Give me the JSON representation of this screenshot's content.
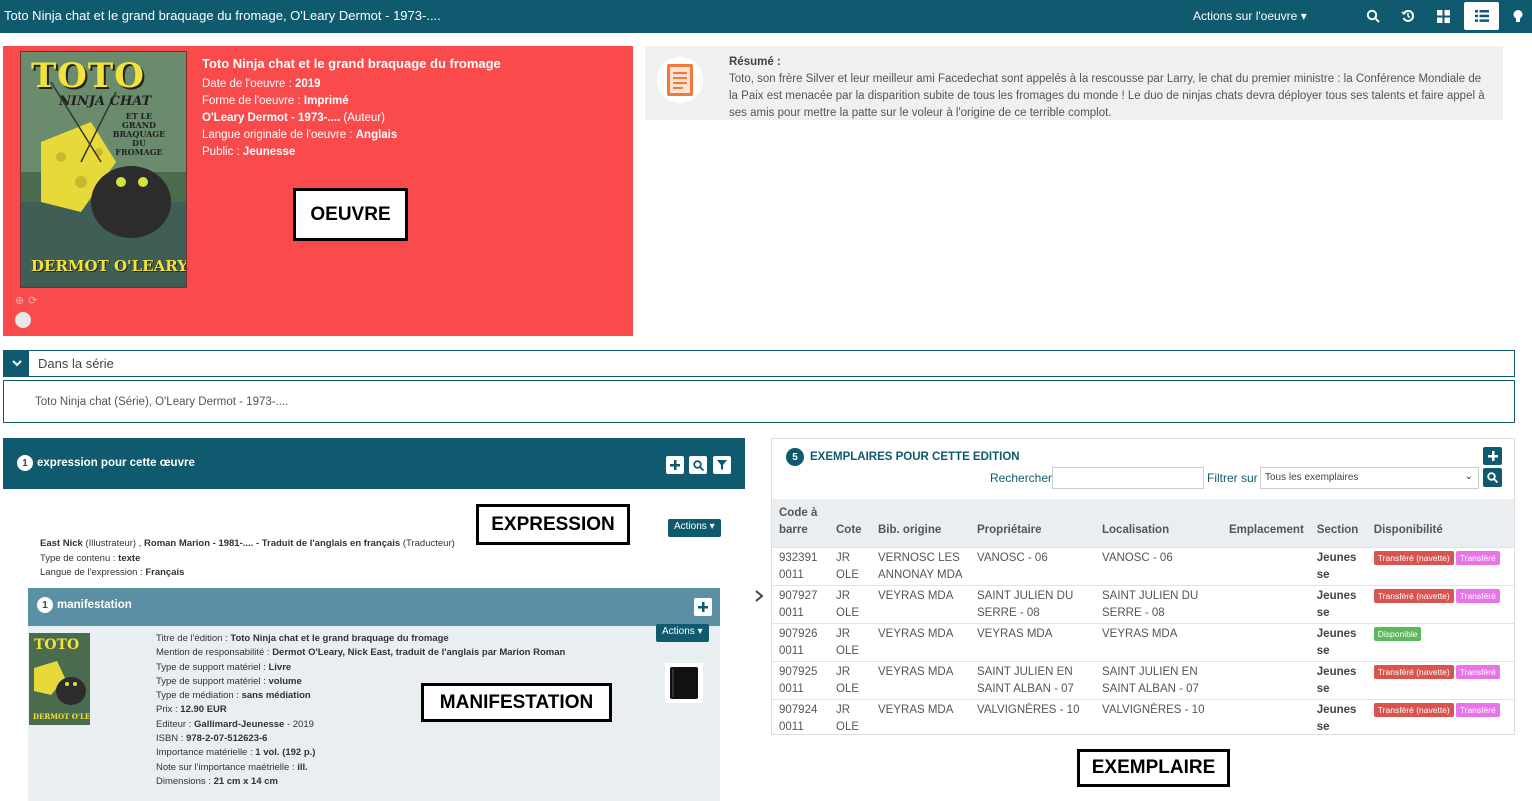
{
  "topbar": {
    "title": "Toto Ninja chat et le grand braquage du fromage, O'Leary Dermot - 1973-....",
    "actions_label": "Actions sur l'oeuvre",
    "icons": [
      "search-icon",
      "history-icon",
      "grid-view-icon",
      "list-view-icon",
      "bulb-icon"
    ]
  },
  "oeuvre": {
    "title": "Toto Ninja chat et le grand braquage du fromage",
    "date_label": "Date de l'oeuvre : ",
    "date_value": "2019",
    "forme_label": "Forme de l'oeuvre : ",
    "forme_value": "Imprimé",
    "author_value": "O'Leary Dermot - 1973-....",
    "author_role": " (Auteur)",
    "langue_label": "Langue originale de l'oeuvre : ",
    "langue_value": "Anglais",
    "public_label": "Public : ",
    "public_value": "Jeunesse",
    "cover_title": "TOTO",
    "cover_subtitle": "NINJA CHAT",
    "cover_sub2": "ET LE GRAND BRAQUAGE DU FROMAGE",
    "cover_author": "DERMOT O'LEARY",
    "annotation": "OEUVRE"
  },
  "resume": {
    "label": "Résumé :",
    "text": "Toto, son frère Silver et leur meilleur ami Facedechat sont appelés à la rescousse par Larry, le chat du premier ministre : la Conférence Mondiale de la Paix est menacée par la disparition subite de tous les fromages du monde ! Le duo de ninjas chats devra déployer tous ses talents et faire appel à ses amis pour mettre la patte sur le voleur à l'origine de ce terrible complot."
  },
  "series": {
    "label": "Dans la série",
    "text": "Toto Ninja chat (Série), O'Leary Dermot - 1973-...."
  },
  "expression": {
    "count": "1",
    "title": "expression pour cette œuvre",
    "annotation": "EXPRESSION",
    "actions_label": "Actions",
    "contrib_name1": "East Nick",
    "contrib_role1": " (Illustrateur) , ",
    "contrib_name2": "Roman Marion - 1981-.... - Traduit de l'anglais en français",
    "contrib_role2": " (Traducteur)",
    "type_label": "Type de contenu : ",
    "type_value": "texte",
    "langue_label": "Langue de l'expression : ",
    "langue_value": "Français"
  },
  "manifestation": {
    "count": "1",
    "title": "manifestation",
    "annotation": "MANIFESTATION",
    "actions_label": "Actions",
    "lines": [
      {
        "label": "Titre de l'édition : ",
        "value": "Toto Ninja chat et le grand braquage du fromage"
      },
      {
        "label": "Mention de responsabilité : ",
        "value": "Dermot O'Leary,  Nick East,  traduit de l'anglais par Marion Roman"
      },
      {
        "label": "Type de support matériel : ",
        "value": "Livre"
      },
      {
        "label": "Type de support matériel : ",
        "value": "volume"
      },
      {
        "label": "Type de médiation : ",
        "value": "sans médiation"
      },
      {
        "label": "Prix : ",
        "value": "12.90 EUR"
      },
      {
        "label": "Editeur : ",
        "value": "Gallimard-Jeunesse",
        "extra": " - 2019"
      },
      {
        "label": "ISBN : ",
        "value": "978-2-07-512623-6"
      },
      {
        "label": "Importance matérielle : ",
        "value": "1 vol. (192 p.)"
      },
      {
        "label": "Note sur l'importance maétrielle : ",
        "value": "ill."
      },
      {
        "label": "Dimensions : ",
        "value": "21 cm x 14 cm"
      }
    ]
  },
  "exemplaires": {
    "count": "5",
    "title": "EXEMPLAIRES POUR CETTE EDITION",
    "annotation": "EXEMPLAIRE",
    "search_label": "Rechercher",
    "search_value": "",
    "filter_label": "Filtrer sur",
    "filter_value": "Tous les exemplaires",
    "headers": [
      "Code à barre",
      "Cote",
      "Bib. origine",
      "Propriétaire",
      "Localisation",
      "Emplacement",
      "Section",
      "Disponibilité"
    ],
    "rows": [
      {
        "code": "932391 0011",
        "cote": "JR OLE",
        "bib": "VERNOSC LES ANNONAY MDA",
        "proprio": "VANOSC - 06",
        "loc": "VANOSC - 06",
        "empl": "",
        "section": "Jeunes se",
        "status": [
          {
            "text": "Transféré (navette)",
            "kind": "red"
          },
          {
            "text": "Transféré",
            "kind": "pink"
          }
        ]
      },
      {
        "code": "907927 0011",
        "cote": "JR OLE",
        "bib": "VEYRAS MDA",
        "proprio": "SAINT JULIEN DU SERRE - 08",
        "loc": "SAINT JULIEN DU SERRE - 08",
        "empl": "",
        "section": "Jeunes se",
        "status": [
          {
            "text": "Transféré (navette)",
            "kind": "red"
          },
          {
            "text": "Transféré",
            "kind": "pink"
          }
        ]
      },
      {
        "code": "907926 0011",
        "cote": "JR OLE",
        "bib": "VEYRAS MDA",
        "proprio": "VEYRAS MDA",
        "loc": "VEYRAS MDA",
        "empl": "",
        "section": "Jeunes se",
        "status": [
          {
            "text": "Disponible",
            "kind": "green"
          }
        ]
      },
      {
        "code": "907925 0011",
        "cote": "JR OLE",
        "bib": "VEYRAS MDA",
        "proprio": "SAINT JULIEN EN SAINT ALBAN - 07",
        "loc": "SAINT JULIEN EN SAINT ALBAN - 07",
        "empl": "",
        "section": "Jeunes se",
        "status": [
          {
            "text": "Transféré (navette)",
            "kind": "red"
          },
          {
            "text": "Transféré",
            "kind": "pink"
          }
        ]
      },
      {
        "code": "907924 0011",
        "cote": "JR OLE",
        "bib": "VEYRAS MDA",
        "proprio": "VALVIGNÈRES - 10",
        "loc": "VALVIGNÈRES - 10",
        "empl": "",
        "section": "Jeunes se",
        "status": [
          {
            "text": "Transféré (navette)",
            "kind": "red"
          },
          {
            "text": "Transféré",
            "kind": "pink"
          }
        ]
      }
    ]
  },
  "colors": {
    "primary": "#0f5a6e",
    "oeuvre_bg": "#f94a4c",
    "manif_head": "#5b8fa3",
    "status_red": "#d9534f",
    "status_pink": "#e874e8",
    "status_green": "#5cb85c"
  }
}
